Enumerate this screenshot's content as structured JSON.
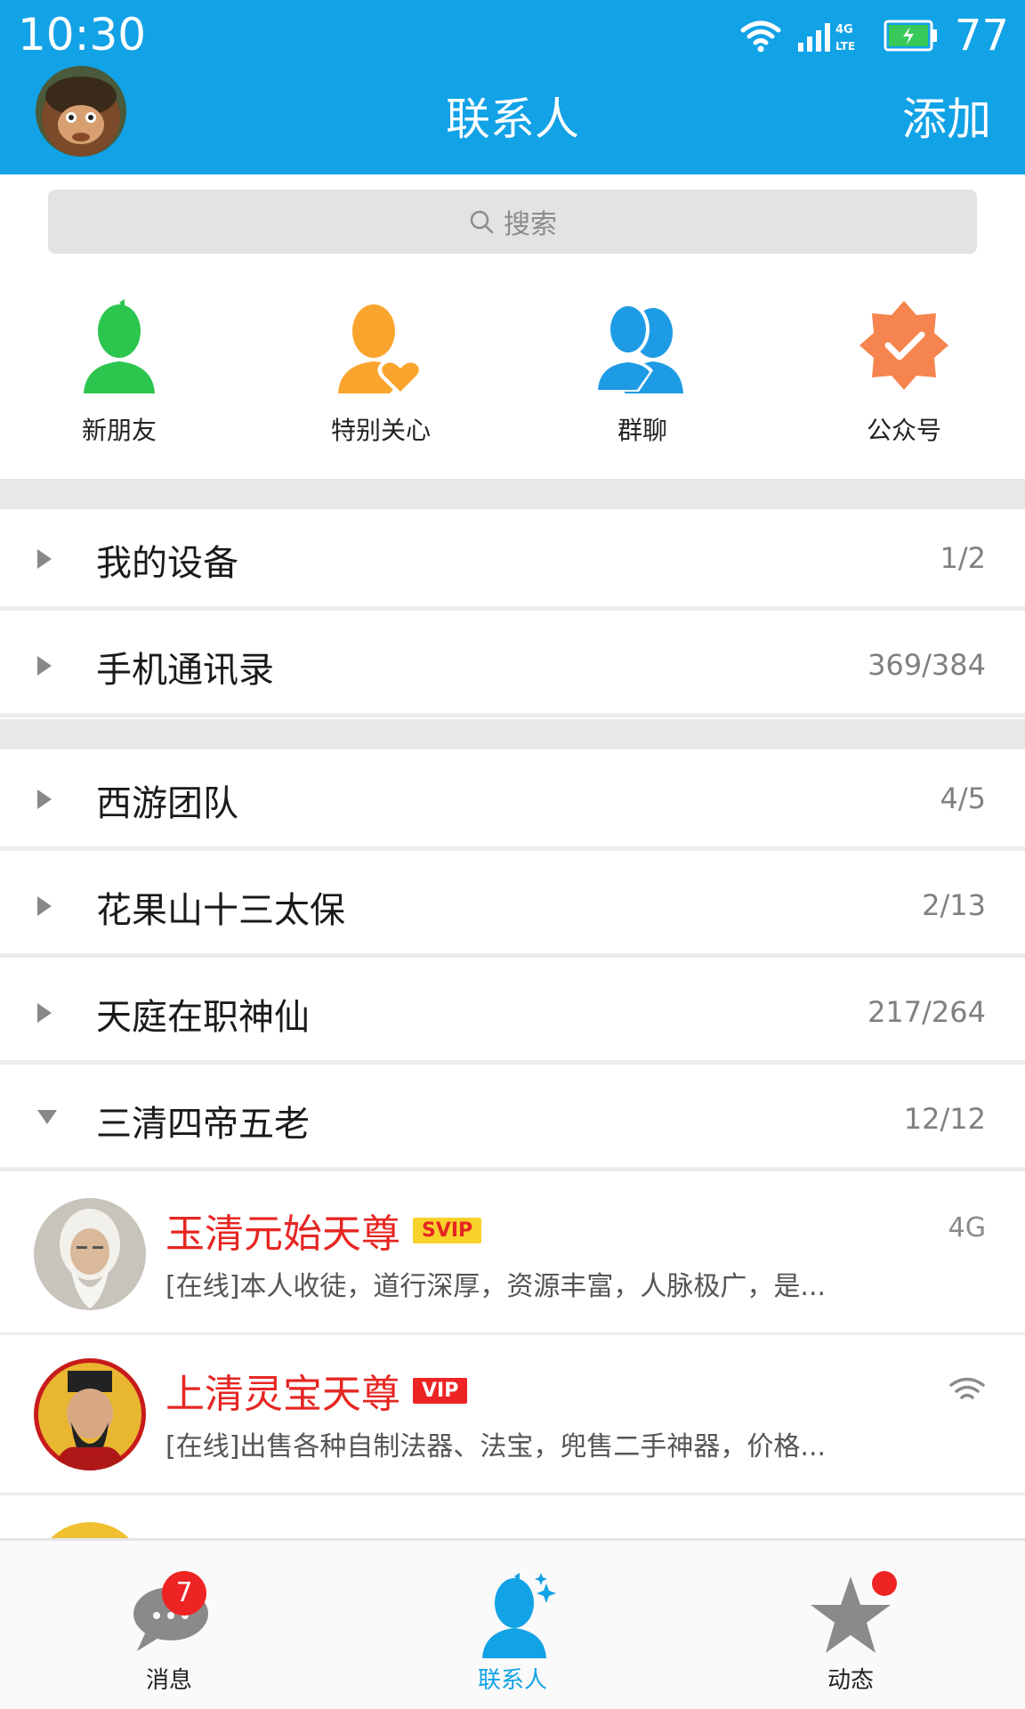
{
  "status_bar": {
    "time": "10:30",
    "network": "4G LTE",
    "battery": "77",
    "icons": [
      "wifi-icon",
      "signal-icon",
      "battery-icon"
    ]
  },
  "header": {
    "title": "联系人",
    "add_label": "添加",
    "avatar_icon": "user-avatar"
  },
  "search": {
    "placeholder": "搜索"
  },
  "quick_entries": [
    {
      "label": "新朋友",
      "icon": "new-friend-icon",
      "color": "#2CC54E"
    },
    {
      "label": "特别关心",
      "icon": "special-care-icon",
      "color": "#F9A52D"
    },
    {
      "label": "群聊",
      "icon": "group-chat-icon",
      "color": "#1E9BE5"
    },
    {
      "label": "公众号",
      "icon": "official-account-icon",
      "color": "#F6844E"
    }
  ],
  "groups": [
    {
      "name": "我的设备",
      "count": "1/2",
      "expanded": false
    },
    {
      "name": "手机通讯录",
      "count": "369/384",
      "expanded": false
    },
    {
      "name": "西游团队",
      "count": "4/5",
      "expanded": false
    },
    {
      "name": "花果山十三太保",
      "count": "2/13",
      "expanded": false
    },
    {
      "name": "天庭在职神仙",
      "count": "217/264",
      "expanded": false
    },
    {
      "name": "三清四帝五老",
      "count": "12/12",
      "expanded": true
    }
  ],
  "contacts": [
    {
      "name": "玉清元始天尊",
      "badge": "SVIP",
      "status": "[在线]本人收徒，道行深厚，资源丰富，人脉极广，是...",
      "network": "4G"
    },
    {
      "name": "上清灵宝天尊",
      "badge": "VIP",
      "status": "[在线]出售各种自制法器、法宝，兜售二手神器，价格...",
      "network": "wifi-icon"
    }
  ],
  "bottom_nav": [
    {
      "label": "消息",
      "icon": "message-icon",
      "badge": "7"
    },
    {
      "label": "联系人",
      "icon": "contacts-icon",
      "active": true
    },
    {
      "label": "动态",
      "icon": "star-icon",
      "dot": true
    }
  ],
  "colors": {
    "primary": "#12A2E6",
    "name_red": "#E62622",
    "badge_red": "#EE2424"
  }
}
